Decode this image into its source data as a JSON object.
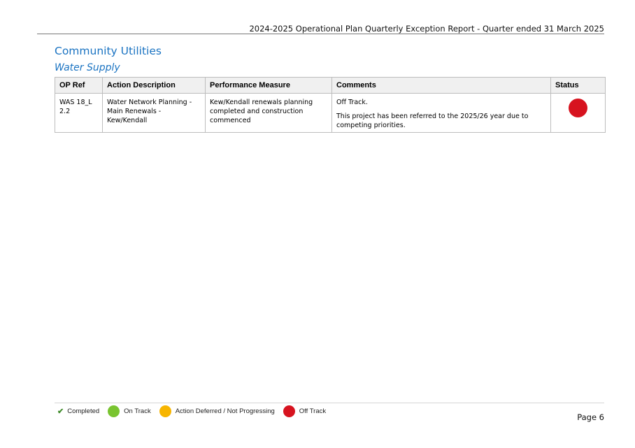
{
  "header": {
    "title": "2024-2025 Operational Plan Quarterly Exception Report - Quarter ended 31 March 2025"
  },
  "section": {
    "title": "Community Utilities",
    "subtitle": "Water Supply"
  },
  "table": {
    "columns": [
      "OP Ref",
      "Action Description",
      "Performance Measure",
      "Comments",
      "Status"
    ],
    "rows": [
      {
        "op_ref": "WAS 18_L 2.2",
        "action": "Water Network Planning - Main Renewals - Kew/Kendall",
        "measure": "Kew/Kendall renewals planning completed and construction commenced",
        "comment_status": "Off Track.",
        "comment_detail": "This project has been referred to the 2025/26 year due to competing priorities.",
        "status_color": "#d7131f"
      }
    ]
  },
  "legend": {
    "items": [
      {
        "label": "Completed",
        "icon": "check-icon",
        "color": "#3f8a2a"
      },
      {
        "label": "On Track",
        "icon": "green-dot",
        "color": "#79c430"
      },
      {
        "label": "Action Deferred / Not Progressing",
        "icon": "amber-dot",
        "color": "#f7b500"
      },
      {
        "label": "Off Track",
        "icon": "red-dot",
        "color": "#d7131f"
      }
    ]
  },
  "footer": {
    "page_label": "Page 6"
  }
}
